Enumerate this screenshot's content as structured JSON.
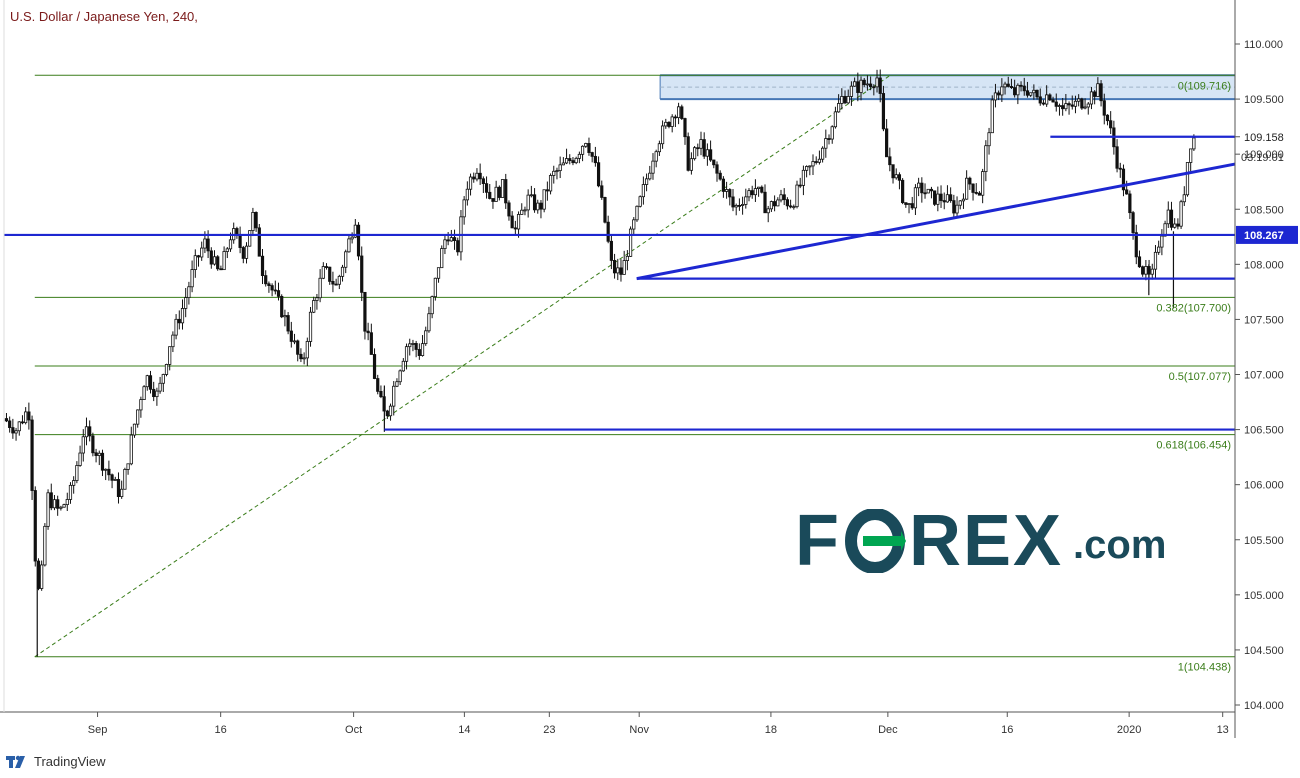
{
  "title": "U.S. Dollar / Japanese Yen, 240,",
  "brand": {
    "tradingview": "TradingView",
    "forex_word_left": "F",
    "forex_word_right": "REX",
    "forex_suffix": ".com"
  },
  "colors": {
    "fib": "#3a7d1a",
    "blue": "#1d27d1",
    "zone_fill": "#cfe0f3",
    "zone_border": "#4677b5",
    "candle": "#111111",
    "logo": "#1a4a5a",
    "logo_accent": "#00a551"
  },
  "chart_data": {
    "type": "candlestick",
    "symbol": "U.S. Dollar / Japanese Yen",
    "interval": "240",
    "ylim": [
      103.9,
      110.4
    ],
    "xlim": [
      0,
      100
    ],
    "y_ticks": [
      "104.000",
      "104.500",
      "105.000",
      "105.500",
      "106.000",
      "106.500",
      "107.000",
      "107.500",
      "108.000",
      "108.500",
      "109.000",
      "109.500",
      "110.000"
    ],
    "x_ticks": [
      {
        "label": "Sep",
        "x": 7.6
      },
      {
        "label": "16",
        "x": 17.6
      },
      {
        "label": "Oct",
        "x": 28.4
      },
      {
        "label": "14",
        "x": 37.4
      },
      {
        "label": "23",
        "x": 44.3
      },
      {
        "label": "Nov",
        "x": 51.6
      },
      {
        "label": "18",
        "x": 62.3
      },
      {
        "label": "Dec",
        "x": 71.8
      },
      {
        "label": "16",
        "x": 81.5
      },
      {
        "label": "2020",
        "x": 91.4
      },
      {
        "label": "13",
        "x": 99.0
      }
    ],
    "current_price": "109.158",
    "countdown": "03:19:01",
    "price_marker": "108.267",
    "fib_levels": [
      {
        "label": "0(109.716)",
        "value": 109.716
      },
      {
        "label": "0.382(107.700)",
        "value": 107.7
      },
      {
        "label": "0.5(107.077)",
        "value": 107.077
      },
      {
        "label": "0.618(106.454)",
        "value": 106.454
      },
      {
        "label": "1(104.438)",
        "value": 104.438
      }
    ],
    "fib_x_start": 2.5,
    "fib_trend": {
      "x1": 2.5,
      "y1": 104.438,
      "x2": 72.0,
      "y2": 109.716
    },
    "resistance_zone": {
      "x1": 53.3,
      "x2": 100,
      "y1": 109.5,
      "y2": 109.716
    },
    "horizontal_lines": [
      {
        "name": "support-108-267",
        "y": 108.267,
        "x1": 0,
        "x2": 100
      },
      {
        "name": "high-109-158",
        "y": 109.158,
        "x1": 85.0,
        "x2": 100
      },
      {
        "name": "low-107-87",
        "y": 107.87,
        "x1": 51.4,
        "x2": 100
      },
      {
        "name": "low-106-5",
        "y": 106.5,
        "x1": 30.9,
        "x2": 100
      }
    ],
    "trendlines": [
      {
        "name": "rising-trendline",
        "x1": 51.4,
        "y1": 107.87,
        "x2": 100,
        "y2": 108.91
      }
    ],
    "price_path": [
      [
        0,
        106.6
      ],
      [
        1.0,
        106.5
      ],
      [
        2.0,
        106.7
      ],
      [
        2.6,
        105.2
      ],
      [
        2.9,
        104.95
      ],
      [
        3.5,
        105.9
      ],
      [
        4.5,
        105.75
      ],
      [
        5.5,
        105.95
      ],
      [
        6.5,
        106.5
      ],
      [
        7.5,
        106.3
      ],
      [
        8.5,
        106.1
      ],
      [
        9.5,
        105.9
      ],
      [
        10.5,
        106.5
      ],
      [
        11.5,
        107.0
      ],
      [
        12.5,
        106.8
      ],
      [
        13.5,
        107.3
      ],
      [
        14.5,
        107.6
      ],
      [
        15.5,
        108.0
      ],
      [
        16.3,
        108.2
      ],
      [
        17.5,
        107.9
      ],
      [
        18.5,
        108.3
      ],
      [
        19.5,
        108.1
      ],
      [
        20.2,
        108.45
      ],
      [
        21.0,
        107.95
      ],
      [
        22.5,
        107.6
      ],
      [
        23.5,
        107.3
      ],
      [
        24.2,
        107.05
      ],
      [
        25.0,
        107.6
      ],
      [
        26.0,
        107.95
      ],
      [
        27.0,
        107.8
      ],
      [
        28.0,
        108.2
      ],
      [
        28.6,
        108.45
      ],
      [
        29.2,
        107.5
      ],
      [
        29.8,
        107.2
      ],
      [
        30.3,
        106.85
      ],
      [
        31.0,
        106.6
      ],
      [
        31.8,
        106.95
      ],
      [
        32.8,
        107.3
      ],
      [
        33.8,
        107.2
      ],
      [
        34.5,
        107.5
      ],
      [
        35.3,
        108.0
      ],
      [
        36.0,
        108.3
      ],
      [
        36.8,
        108.1
      ],
      [
        37.5,
        108.7
      ],
      [
        38.5,
        108.9
      ],
      [
        39.5,
        108.6
      ],
      [
        40.5,
        108.7
      ],
      [
        41.5,
        108.3
      ],
      [
        42.5,
        108.6
      ],
      [
        43.5,
        108.5
      ],
      [
        44.5,
        108.8
      ],
      [
        45.5,
        108.9
      ],
      [
        46.5,
        109.0
      ],
      [
        47.3,
        109.15
      ],
      [
        48.0,
        108.9
      ],
      [
        48.8,
        108.4
      ],
      [
        49.4,
        107.95
      ],
      [
        50.2,
        107.92
      ],
      [
        51.0,
        108.3
      ],
      [
        52.0,
        108.7
      ],
      [
        53.0,
        109.1
      ],
      [
        54.0,
        109.3
      ],
      [
        54.8,
        109.45
      ],
      [
        55.6,
        108.9
      ],
      [
        56.6,
        109.1
      ],
      [
        57.5,
        108.9
      ],
      [
        58.5,
        108.7
      ],
      [
        59.3,
        108.5
      ],
      [
        60.0,
        108.6
      ],
      [
        61.0,
        108.7
      ],
      [
        62.0,
        108.5
      ],
      [
        63.0,
        108.6
      ],
      [
        64.0,
        108.55
      ],
      [
        65.0,
        108.8
      ],
      [
        66.0,
        108.95
      ],
      [
        67.0,
        109.2
      ],
      [
        68.0,
        109.5
      ],
      [
        69.0,
        109.6
      ],
      [
        70.2,
        109.65
      ],
      [
        71.0,
        109.7
      ],
      [
        71.6,
        109.0
      ],
      [
        72.4,
        108.8
      ],
      [
        73.4,
        108.5
      ],
      [
        74.4,
        108.7
      ],
      [
        75.4,
        108.6
      ],
      [
        76.4,
        108.6
      ],
      [
        77.3,
        108.5
      ],
      [
        78.3,
        108.75
      ],
      [
        79.3,
        108.65
      ],
      [
        80.2,
        109.4
      ],
      [
        81.0,
        109.65
      ],
      [
        82.0,
        109.55
      ],
      [
        83.0,
        109.6
      ],
      [
        84.0,
        109.5
      ],
      [
        85.0,
        109.55
      ],
      [
        86.0,
        109.4
      ],
      [
        87.0,
        109.45
      ],
      [
        88.0,
        109.5
      ],
      [
        88.8,
        109.6
      ],
      [
        89.8,
        109.25
      ],
      [
        90.5,
        108.9
      ],
      [
        91.2,
        108.6
      ],
      [
        91.8,
        108.2
      ],
      [
        92.5,
        107.95
      ],
      [
        93.2,
        107.85
      ],
      [
        93.8,
        108.2
      ],
      [
        94.5,
        108.5
      ],
      [
        95.2,
        108.3
      ],
      [
        95.8,
        108.6
      ],
      [
        96.3,
        109.1
      ],
      [
        96.7,
        109.15
      ]
    ]
  }
}
